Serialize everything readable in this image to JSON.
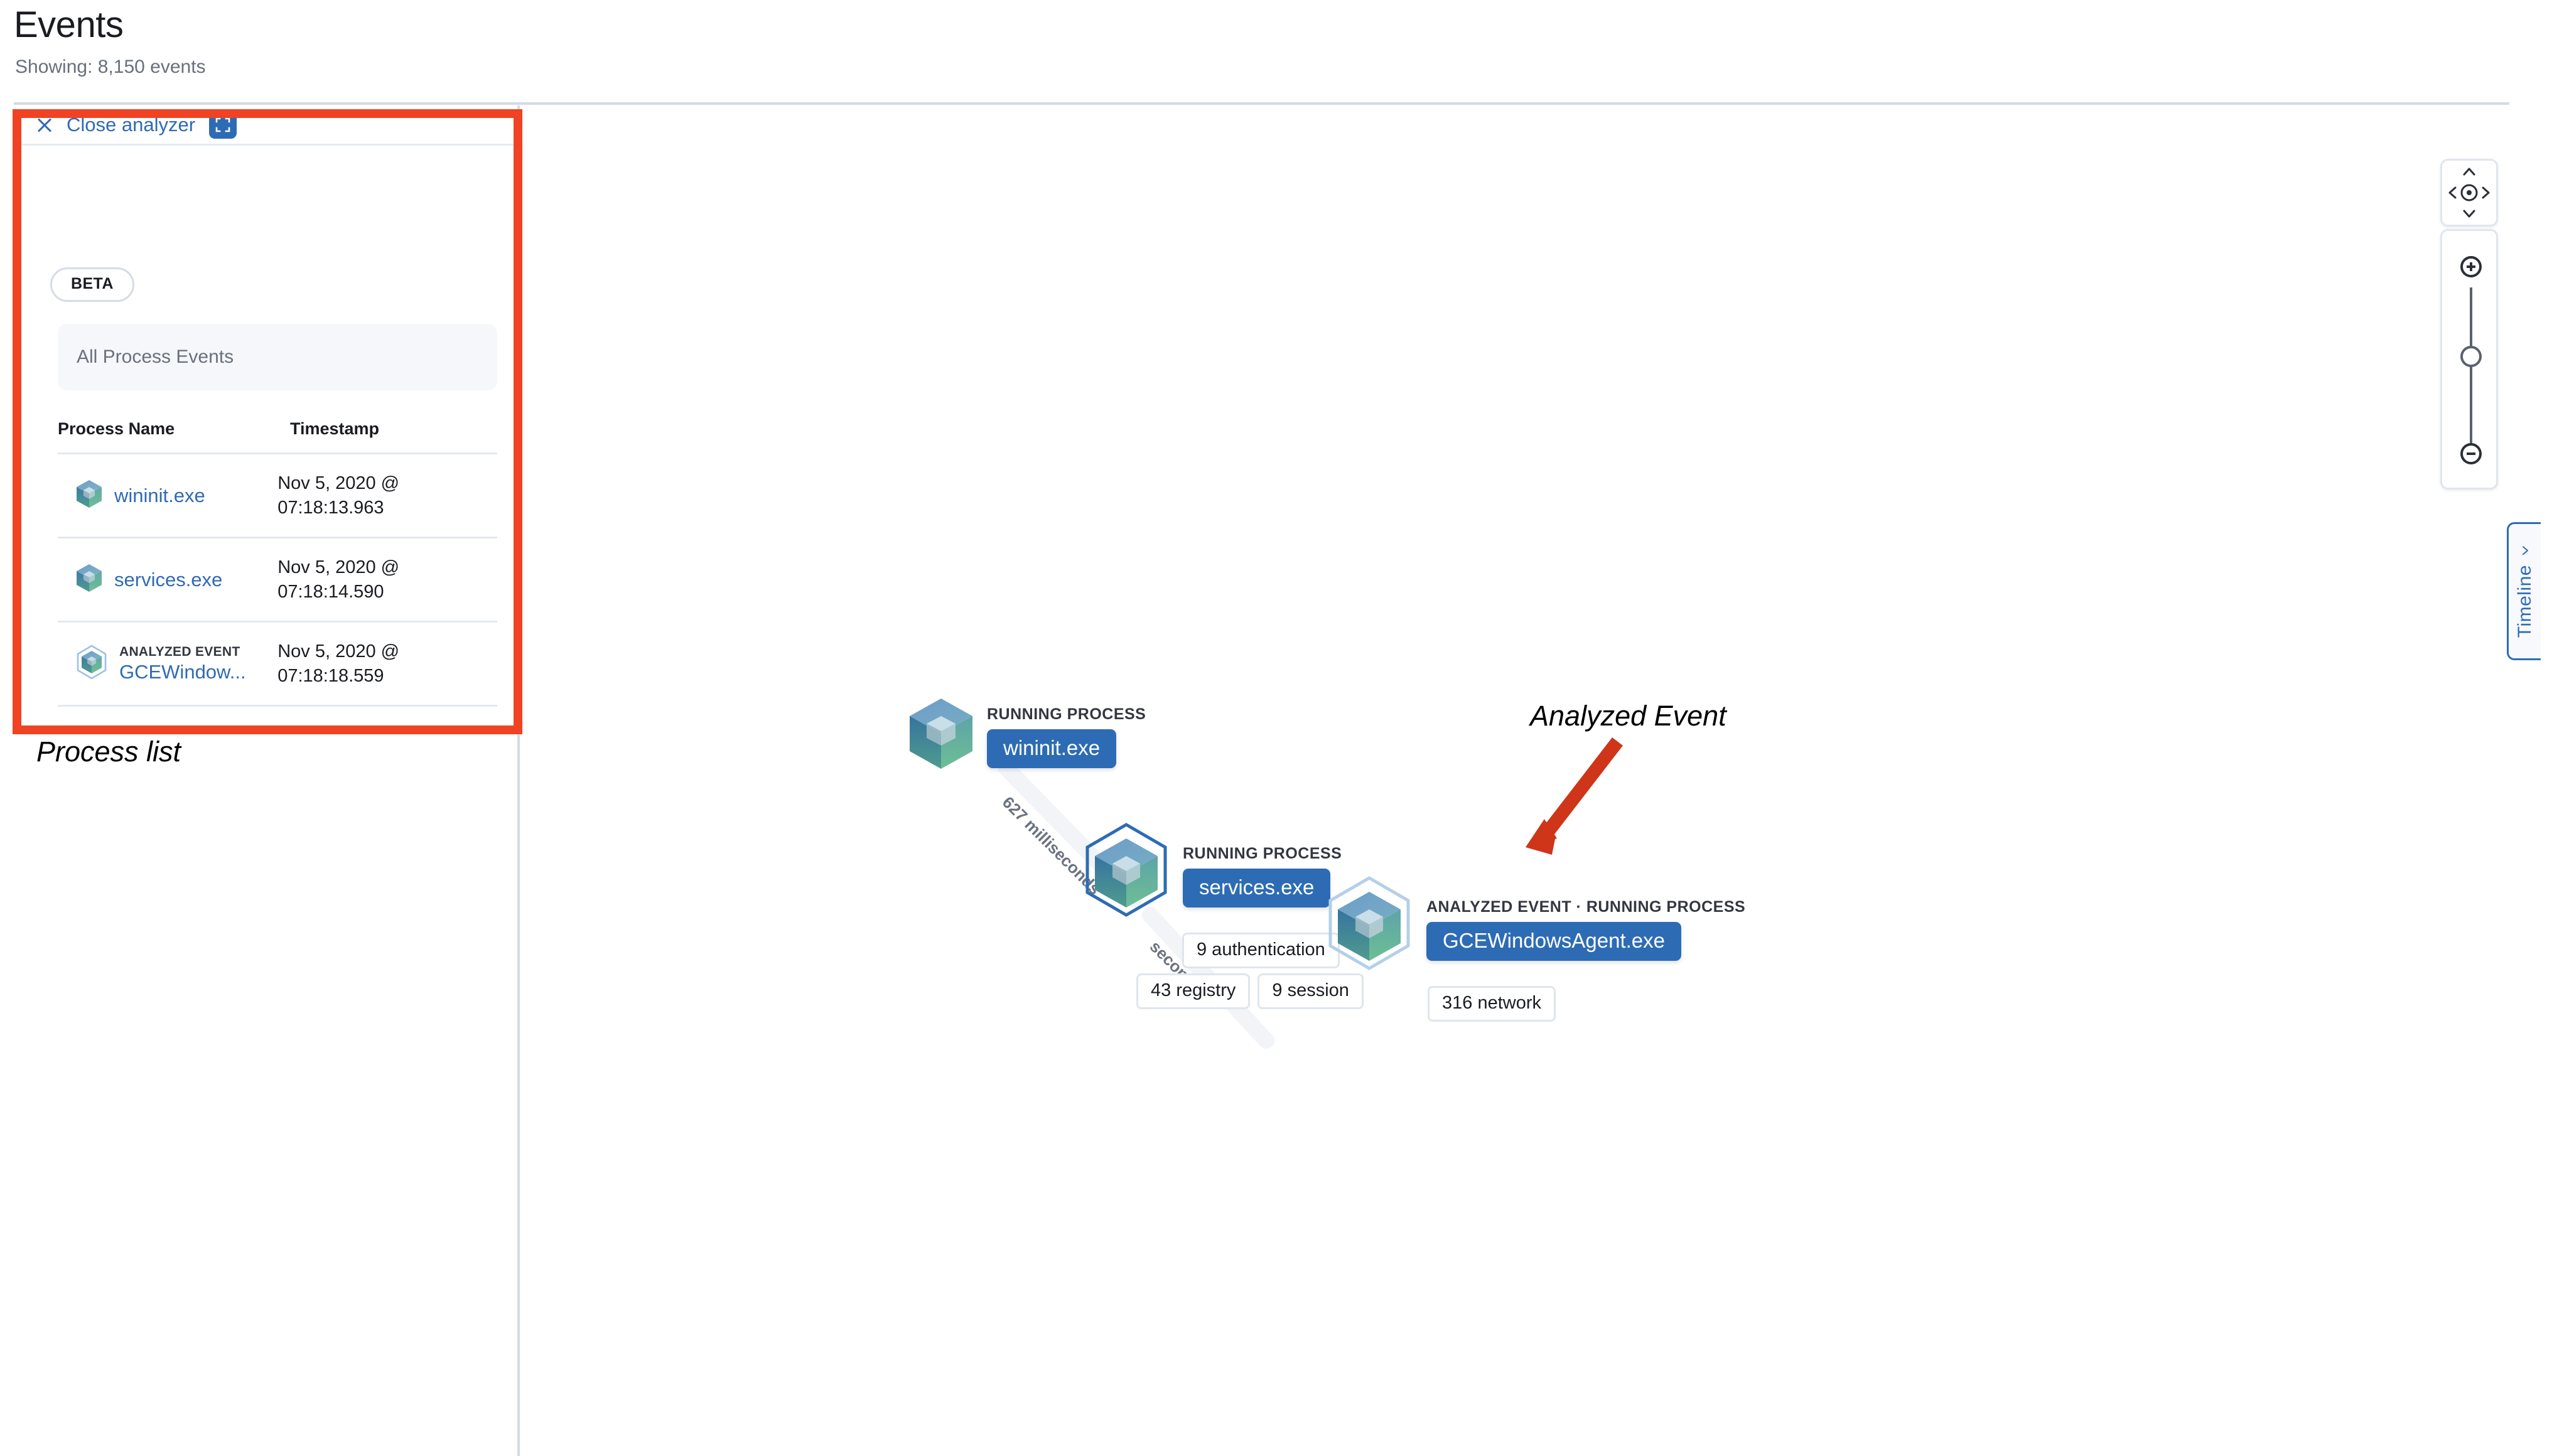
{
  "header": {
    "title": "Events",
    "subtitle": "Showing: 8,150 events"
  },
  "analyzer_panel": {
    "close_label": "Close analyzer",
    "close_icon": "close-x-icon",
    "fullscreen_icon": "fullscreen-icon",
    "beta_badge": "BETA",
    "breadcrumb": "All Process Events",
    "table": {
      "columns": [
        "Process Name",
        "Timestamp"
      ],
      "rows": [
        {
          "tag": "",
          "name": "wininit.exe",
          "timestamp": "Nov 5, 2020 @ 07:18:13.963",
          "icon": "cube-icon"
        },
        {
          "tag": "",
          "name": "services.exe",
          "timestamp": "Nov 5, 2020 @ 07:18:14.590",
          "icon": "cube-icon"
        },
        {
          "tag": "ANALYZED EVENT",
          "name": "GCEWindow...",
          "timestamp": "Nov 5, 2020 @ 07:18:18.559",
          "icon": "cube-hex-icon"
        }
      ]
    }
  },
  "annotations": {
    "process_list": "Process list",
    "analyzed_event": "Analyzed Event",
    "box_color": "#ef4323",
    "arrow_color": "#ce3519"
  },
  "graph": {
    "nodes": [
      {
        "kind": "RUNNING PROCESS",
        "label": "wininit.exe",
        "icon": "cube-icon",
        "selected": false,
        "badges": []
      },
      {
        "kind": "RUNNING PROCESS",
        "label": "services.exe",
        "icon": "cube-icon",
        "selected": true,
        "badges": [
          "9 authentication",
          "43 registry",
          "9 session"
        ]
      },
      {
        "kind": "ANALYZED EVENT · RUNNING PROCESS",
        "label": "GCEWindowsAgent.exe",
        "icon": "cube-icon",
        "selected": true,
        "badges": [
          "316 network"
        ]
      }
    ],
    "edges": [
      {
        "label": "627 milliseconds"
      },
      {
        "label": "seconds"
      }
    ],
    "node_pill_color": "#2d6cb4"
  },
  "map_controls": {
    "pan_up_icon": "chevron-up-icon",
    "pan_down_icon": "chevron-down-icon",
    "pan_left_icon": "chevron-left-icon",
    "pan_right_icon": "chevron-right-icon",
    "center_icon": "crosshair-icon",
    "zoom_in_icon": "plus-circle-icon",
    "zoom_out_icon": "minus-circle-icon",
    "zoom_slider_icon": "slider-knob"
  },
  "timeline_tab": {
    "label": "Timeline",
    "chevron_icon": "chevron-left-icon"
  }
}
